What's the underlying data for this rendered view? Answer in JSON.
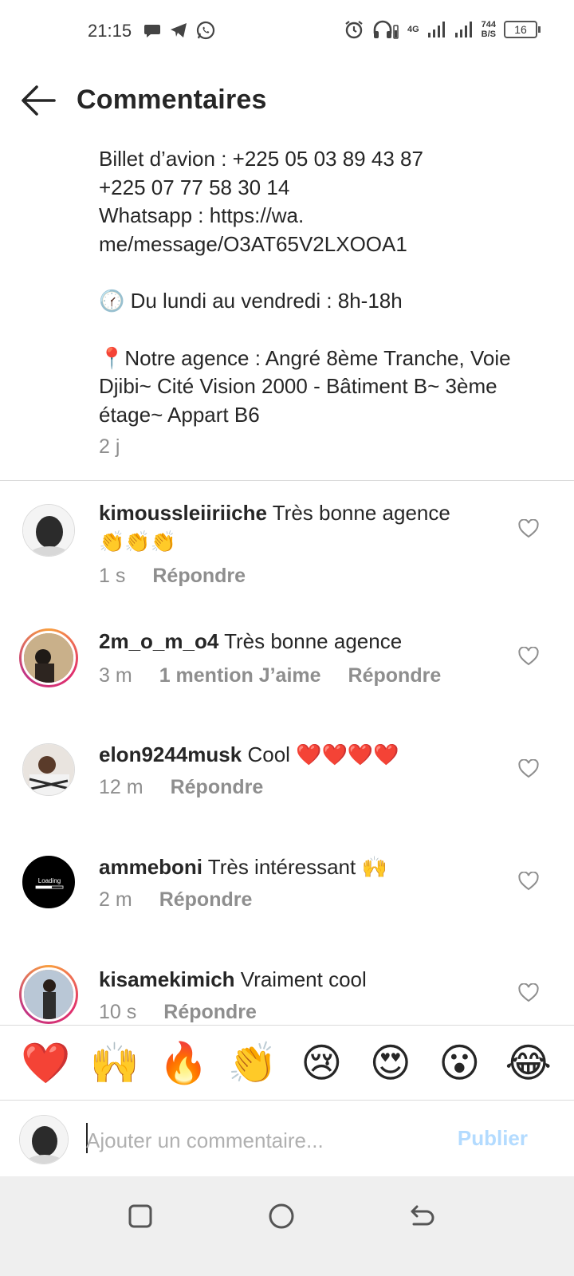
{
  "status_bar": {
    "time": "21:15",
    "left_icons": [
      "message-icon",
      "telegram-icon",
      "whatsapp-icon"
    ],
    "right_icons": [
      "alarm-icon",
      "headphones-icon",
      "signal-4g-icon",
      "signal-icon"
    ],
    "network_type": "4G",
    "net_speed_value": "744",
    "net_speed_unit": "B/S",
    "battery": "16"
  },
  "header": {
    "title": "Commentaires"
  },
  "caption": {
    "line1": "Billet d’avion : +225 05 03 89 43 87",
    "line2": "+225 07 77 58 30 14",
    "line3": "Whatsapp : https://wa.",
    "line4": "me/message/O3AT65V2LXOOA1",
    "hours": "🕜 Du lundi au vendredi : 8h-18h",
    "address": "📍Notre agence : Angré 8ème Tranche, Voie Djibi~ Cité Vision 2000 - Bâtiment B~ 3ème étage~ Appart B6",
    "time": "2 j"
  },
  "comments": [
    {
      "username": "kimoussleiiriiche",
      "text": "Très bonne agence👏👏👏",
      "time": "1 s",
      "likes": "",
      "reply": "Répondre"
    },
    {
      "username": "2m_o_m_o4",
      "text": "Très bonne agence",
      "time": "3 m",
      "likes": "1 mention J’aime",
      "reply": "Répondre"
    },
    {
      "username": "elon9244musk",
      "text": "Cool ❤️❤️❤️❤️",
      "time": "12 m",
      "likes": "",
      "reply": "Répondre"
    },
    {
      "username": "ammeboni",
      "text": "Très intéressant 🙌",
      "time": "2 m",
      "likes": "",
      "reply": "Répondre"
    },
    {
      "username": "kisamekimich",
      "text": "Vraiment cool",
      "time": "10 s",
      "likes": "",
      "reply": "Répondre"
    }
  ],
  "avatar_loading_text": "Loading",
  "emoji_bar": [
    "❤️",
    "🙌",
    "🔥",
    "👏",
    "😢",
    "😍",
    "😮",
    "😂"
  ],
  "input": {
    "placeholder": "Ajouter un commentaire...",
    "value": "",
    "publish_label": "Publier"
  },
  "colors": {
    "text": "#262626",
    "secondary": "#8e8e8e",
    "publish_disabled": "#b3dbff",
    "divider": "#dbdbdb"
  }
}
